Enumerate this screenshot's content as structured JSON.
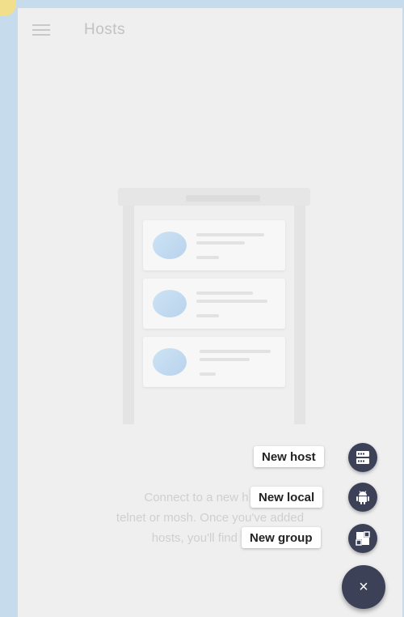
{
  "appbar": {
    "title": "Hosts"
  },
  "empty_state": {
    "line1": "Connect to a new h",
    "line2": "telnet or mosh. Once you've added",
    "line3": "hosts, you'll find t"
  },
  "speed_dial": {
    "actions": [
      {
        "label": "New host",
        "icon": "server-icon"
      },
      {
        "label": "New local",
        "icon": "android-icon"
      },
      {
        "label": "New group",
        "icon": "group-icon"
      }
    ],
    "close_icon": "×"
  },
  "colors": {
    "fab": "#3d4157",
    "background": "#efefef"
  }
}
